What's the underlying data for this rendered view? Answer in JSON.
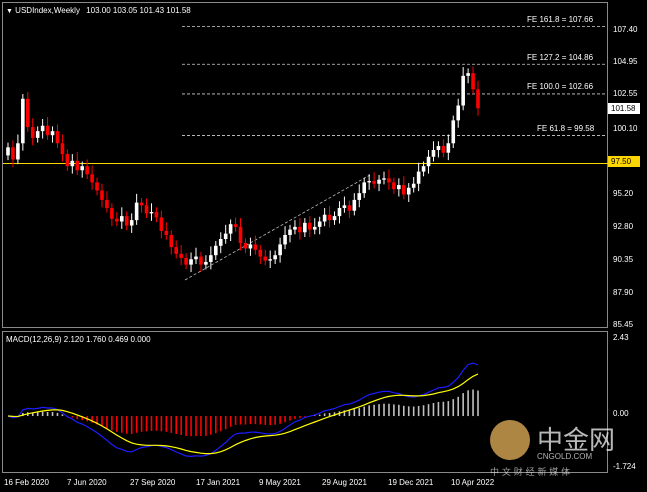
{
  "header": {
    "menu_glyph": "▼",
    "symbol": "USDIndex,Weekly",
    "ohlc": "103.00 103.05 101.43 101.58"
  },
  "macd_header": "MACD(12,26,9) 2.120 1.760 0.469 0.000",
  "price_axis": [
    "107.40",
    "104.95",
    "102.55",
    "100.10",
    "97.50",
    "95.20",
    "92.80",
    "90.35",
    "87.90",
    "85.45"
  ],
  "price_tags": {
    "current": "101.58",
    "level": "97.50"
  },
  "fib_levels": [
    {
      "label": "FE 161.8 = 107.66"
    },
    {
      "label": "FE 127.2 = 104.86"
    },
    {
      "label": "FE 100.0 = 102.66"
    },
    {
      "label": "FE 61.8 = 99.58"
    }
  ],
  "macd_axis": [
    "2.43",
    "0.00",
    "-1.724"
  ],
  "time_axis": [
    "16 Feb 2020",
    "7 Jun 2020",
    "27 Sep 2020",
    "17 Jan 2021",
    "9 May 2021",
    "29 Aug 2021",
    "19 Dec 2021",
    "10 Apr 2022"
  ],
  "watermark": {
    "brand_cn": "中金网",
    "url": "CNGOLD.COM",
    "tagline": "中 文 财 经 新 媒 体"
  },
  "colors": {
    "background": "#000000",
    "bull_candle": "#ffffff",
    "bear_candle": "#ff0000",
    "level_line": "#ffd700",
    "macd_line": "#1c1cff",
    "signal_line": "#ffff00",
    "hist_pos": "#c0c0c0",
    "hist_neg": "#ff0000"
  },
  "chart_data": {
    "type": "candlestick",
    "symbol": "USDIndex",
    "timeframe": "Weekly",
    "last_bar": {
      "open": 103.0,
      "high": 103.05,
      "low": 101.43,
      "close": 101.58
    },
    "horizontal_level": 97.5,
    "fib_extension": [
      107.66,
      104.86,
      102.66,
      99.58
    ],
    "ylim": [
      85.45,
      107.4
    ],
    "close_series": [
      98.7,
      97.8,
      99.0,
      102.3,
      100.2,
      99.4,
      99.9,
      100.3,
      99.6,
      99.9,
      99.0,
      98.2,
      97.3,
      97.7,
      97.0,
      97.3,
      96.7,
      96.1,
      95.5,
      94.8,
      94.2,
      93.4,
      93.2,
      93.6,
      92.9,
      93.3,
      94.6,
      94.4,
      93.8,
      93.9,
      93.5,
      92.5,
      92.2,
      91.3,
      90.8,
      90.5,
      90.0,
      90.4,
      90.6,
      90.0,
      90.2,
      90.7,
      91.4,
      91.9,
      92.3,
      93.0,
      92.8,
      91.6,
      91.2,
      91.5,
      91.1,
      90.6,
      90.3,
      90.4,
      90.7,
      91.5,
      92.2,
      92.6,
      92.8,
      92.4,
      93.1,
      92.6,
      92.8,
      93.2,
      93.7,
      93.3,
      93.6,
      94.2,
      94.4,
      94.0,
      94.8,
      95.3,
      96.1,
      96.2,
      96.0,
      96.3,
      96.4,
      96.1,
      95.6,
      95.9,
      95.2,
      95.7,
      96.0,
      96.9,
      97.3,
      98.0,
      98.5,
      98.8,
      98.3,
      99.0,
      100.7,
      101.8,
      104.0,
      104.2,
      103.0,
      101.6
    ],
    "macd": {
      "macd": 2.12,
      "signal": 1.76,
      "histogram": 0.469,
      "ylim": [
        -1.724,
        2.43
      ]
    }
  }
}
